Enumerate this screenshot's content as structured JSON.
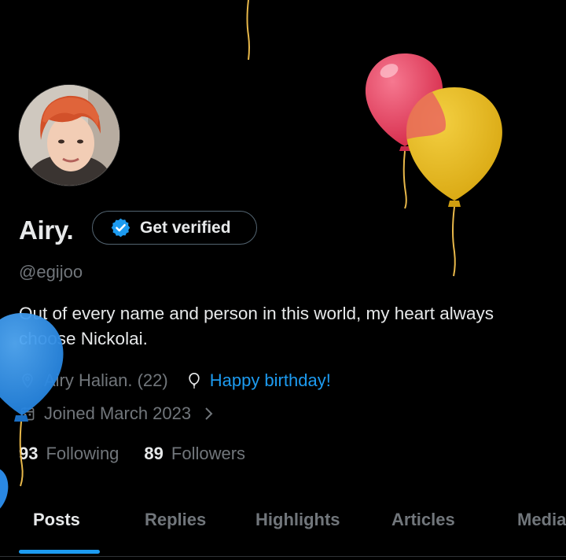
{
  "profile": {
    "name": "Airy.",
    "handle": "@egijoo",
    "bio": "Out of every name and person in this world, my heart always choose Nickolai.",
    "location": "Airy Halian. (22)",
    "birthday_link": "Happy birthday!",
    "joined": "Joined March 2023",
    "verify_button_label": "Get verified"
  },
  "stats": {
    "following_count": "93",
    "following_label": "Following",
    "followers_count": "89",
    "followers_label": "Followers"
  },
  "tabs": [
    {
      "label": "Posts",
      "active": true
    },
    {
      "label": "Replies",
      "active": false
    },
    {
      "label": "Highlights",
      "active": false
    },
    {
      "label": "Articles",
      "active": false
    },
    {
      "label": "Media",
      "active": false
    }
  ],
  "colors": {
    "background": "#000000",
    "accent_blue": "#1d9bf0",
    "text_primary": "#e7e9ea",
    "text_secondary": "#71767b",
    "balloon_red": "#e3405f",
    "balloon_gold": "#e6b820",
    "balloon_blue": "#2f8fe8"
  },
  "icons": {
    "verify": "verified-badge-icon",
    "location": "location-pin-icon",
    "birthday": "balloon-icon",
    "joined": "calendar-icon",
    "expand": "chevron-right-icon"
  }
}
